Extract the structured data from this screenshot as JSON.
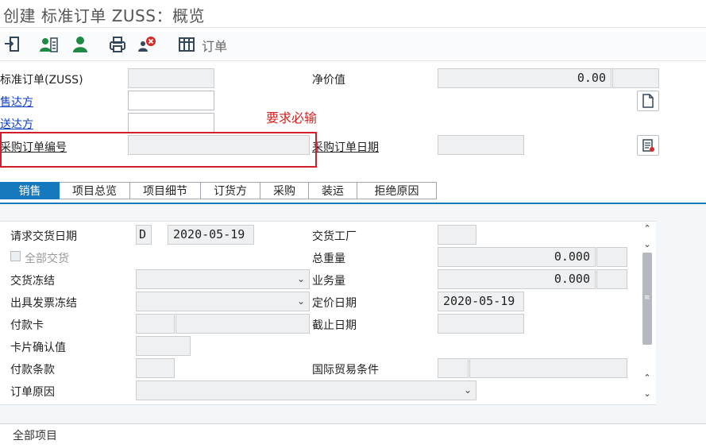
{
  "window": {
    "title": "创建 标准订单 ZUSS：概览"
  },
  "toolbar": {
    "items": [
      {
        "name": "enter-icon"
      },
      {
        "name": "contact-card-icon"
      },
      {
        "name": "user-icon"
      },
      {
        "name": "print-icon"
      },
      {
        "name": "user-delete-icon"
      },
      {
        "name": "grid-icon"
      }
    ],
    "order_label": "订单"
  },
  "header": {
    "order_type_label": "标准订单(ZUSS)",
    "order_type_value": "",
    "net_value_label": "净价值",
    "net_value": "0.00",
    "currency": "",
    "sold_to_label": "售达方",
    "sold_to_value": "",
    "ship_to_label": "送达方",
    "ship_to_value": "",
    "po_number_label": "采购订单编号",
    "po_number_value": "",
    "po_date_label": "采购订单日期",
    "po_date_value": "",
    "annotation": "要求必输"
  },
  "tabs": [
    "销售",
    "项目总览",
    "项目细节",
    "订货方",
    "采购",
    "装运",
    "拒绝原因"
  ],
  "sales": {
    "req_delivery_date_label": "请求交货日期",
    "req_delivery_date_unit": "D",
    "req_delivery_date": "2020-05-19",
    "full_delivery_label": "全部交货",
    "delivery_block_label": "交货冻结",
    "billing_block_label": "出具发票冻结",
    "payment_card_label": "付款卡",
    "card_verification_label": "卡片确认值",
    "payment_terms_label": "付款条款",
    "order_reason_label": "订单原因",
    "plant_label": "交货工厂",
    "total_weight_label": "总重量",
    "total_weight": "0.000",
    "volume_label": "业务量",
    "volume": "0.000",
    "pricing_date_label": "定价日期",
    "pricing_date": "2020-05-19",
    "expiry_date_label": "截止日期",
    "incoterms_label": "国际贸易条件"
  },
  "footer": {
    "all_items_label": "全部项目"
  }
}
